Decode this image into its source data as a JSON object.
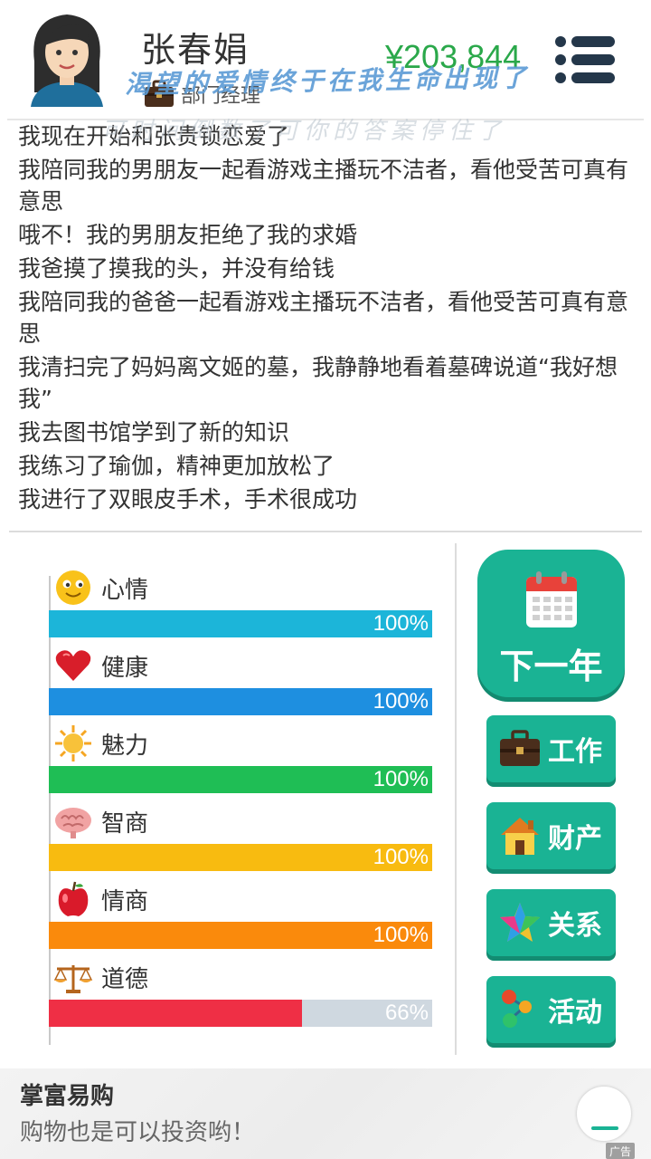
{
  "header": {
    "name": "张春娟",
    "job_title": "部门经理",
    "money": "¥203,844",
    "banner_line1": "渴望的爱情终于在我生命出现了",
    "banner_line2": "可时间倒数了可你的答案停住了"
  },
  "log": [
    "我现在开始和张贵锁恋爱了",
    "我陪同我的男朋友一起看游戏主播玩不洁者，看他受苦可真有意思",
    "哦不！我的男朋友拒绝了我的求婚",
    "我爸摸了摸我的头，并没有给钱",
    "我陪同我的爸爸一起看游戏主播玩不洁者，看他受苦可真有意思",
    "我清扫完了妈妈离文姬的墓，我静静地看着墓碑说道“我好想我”",
    "我去图书馆学到了新的知识",
    "我练习了瑜伽，精神更加放松了",
    "我进行了双眼皮手术，手术很成功"
  ],
  "stats": [
    {
      "label": "心情",
      "value": 100,
      "pct": "100%",
      "color": "#1cb5d9",
      "icon": "smiley-icon"
    },
    {
      "label": "健康",
      "value": 100,
      "pct": "100%",
      "color": "#1e8fe0",
      "icon": "heart-icon"
    },
    {
      "label": "魅力",
      "value": 100,
      "pct": "100%",
      "color": "#1fbe55",
      "icon": "sun-icon"
    },
    {
      "label": "智商",
      "value": 100,
      "pct": "100%",
      "color": "#f8bb10",
      "icon": "brain-icon"
    },
    {
      "label": "情商",
      "value": 100,
      "pct": "100%",
      "color": "#fa8a0c",
      "icon": "apple-icon"
    },
    {
      "label": "道德",
      "value": 66,
      "pct": "66%",
      "color": "#ef2f45",
      "icon": "scales-icon"
    }
  ],
  "buttons": {
    "next_year": "下一年",
    "work": "工作",
    "property": "财产",
    "relations": "关系",
    "activities": "活动"
  },
  "ad": {
    "title": "掌富易购",
    "desc": "购物也是可以投资哟！",
    "tag": "广告"
  }
}
